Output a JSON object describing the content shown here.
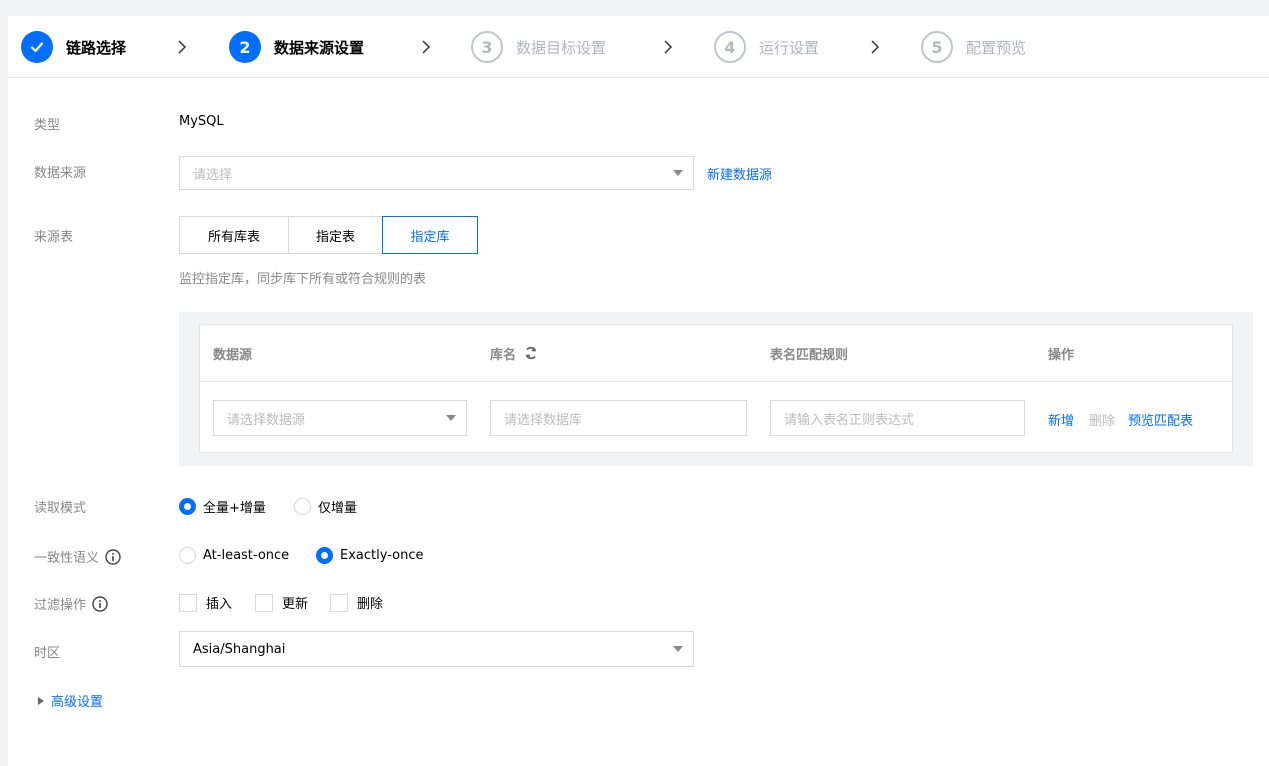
{
  "steps": [
    {
      "num": "",
      "label": "链路选择",
      "state": "done"
    },
    {
      "num": "2",
      "label": "数据来源设置",
      "state": "active"
    },
    {
      "num": "3",
      "label": "数据目标设置",
      "state": "todo"
    },
    {
      "num": "4",
      "label": "运行设置",
      "state": "todo"
    },
    {
      "num": "5",
      "label": "配置预览",
      "state": "todo"
    }
  ],
  "form": {
    "type_label": "类型",
    "type_value": "MySQL",
    "datasource_label": "数据来源",
    "datasource_placeholder": "请选择",
    "new_datasource_link": "新建数据源",
    "source_table_label": "来源表",
    "source_table_options": [
      "所有库表",
      "指定表",
      "指定库"
    ],
    "source_table_selected": "指定库",
    "source_table_hint": "监控指定库，同步库下所有或符合规则的表",
    "table": {
      "headers": [
        "数据源",
        "库名",
        "表名匹配规则",
        "操作"
      ],
      "row": {
        "datasource_placeholder": "请选择数据源",
        "database_placeholder": "请选择数据库",
        "table_rule_placeholder": "请输入表名正则表达式",
        "actions": [
          "新增",
          "删除",
          "预览匹配表"
        ]
      }
    },
    "read_mode_label": "读取模式",
    "read_mode_options": [
      "全量+增量",
      "仅增量"
    ],
    "read_mode_selected": "全量+增量",
    "consistency_label": "一致性语义",
    "consistency_options": [
      "At-least-once",
      "Exactly-once"
    ],
    "consistency_selected": "Exactly-once",
    "filter_label": "过滤操作",
    "filter_options": [
      "插入",
      "更新",
      "删除"
    ],
    "timezone_label": "时区",
    "timezone_value": "Asia/Shanghai",
    "advanced_label": "高级设置"
  },
  "colors": {
    "primary": "#006eff",
    "label_gray": "#888888",
    "border": "#d9d9d9"
  }
}
